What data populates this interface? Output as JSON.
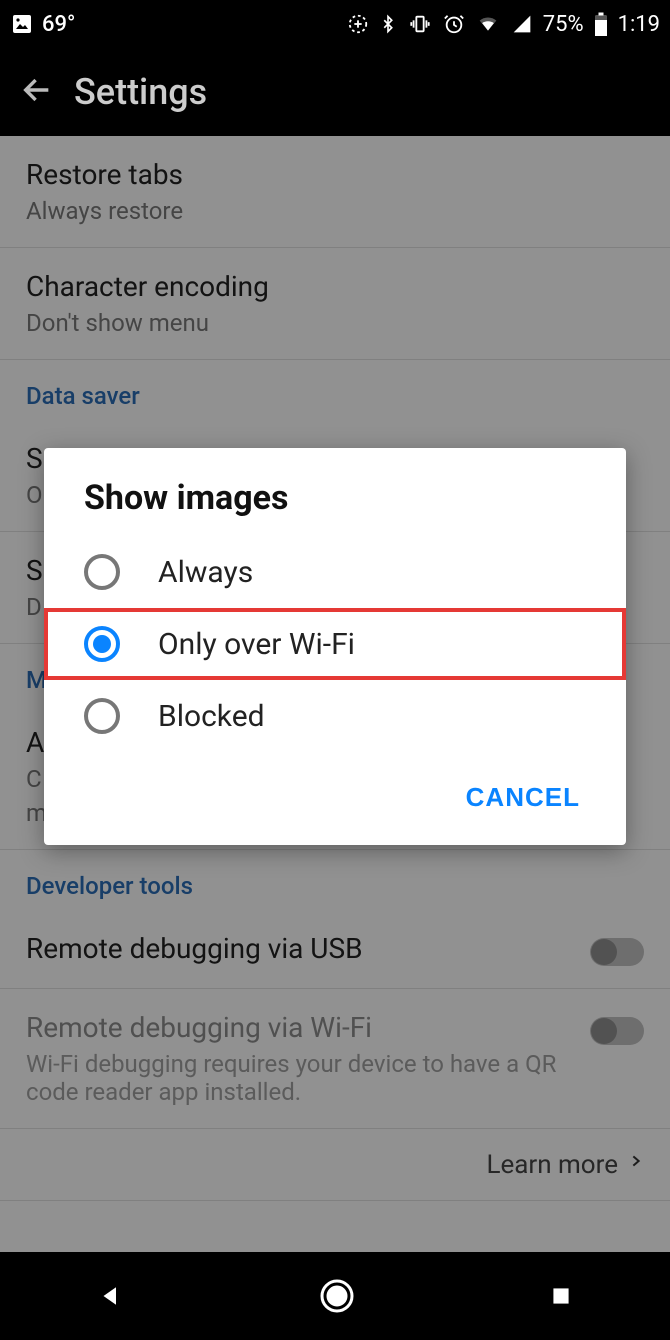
{
  "status_bar": {
    "temperature": "69°",
    "battery_percent": "75%",
    "clock": "1:19"
  },
  "app_bar": {
    "title": "Settings"
  },
  "content": {
    "restore_tabs": {
      "title": "Restore tabs",
      "subtitle": "Always restore"
    },
    "character_encoding": {
      "title": "Character encoding",
      "subtitle": "Don't show menu"
    },
    "section_data_saver": "Data saver",
    "show_images_partial": {
      "title_initial": "S",
      "subtitle_initial": "O"
    },
    "item_partial2": {
      "title_initial": "S",
      "subtitle_initial": "D"
    },
    "section_m": "M",
    "item_a": {
      "title_initial": "A",
      "subtitle1_initial": "C",
      "subtitle2_initial": "m"
    },
    "section_developer_tools": "Developer tools",
    "remote_debug_usb": {
      "title": "Remote debugging via USB"
    },
    "remote_debug_wifi": {
      "title": "Remote debugging via Wi-Fi",
      "subtitle": "Wi-Fi debugging requires your device to have a QR code reader app installed."
    },
    "learn_more": "Learn more"
  },
  "dialog": {
    "title": "Show images",
    "options": [
      {
        "label": "Always",
        "selected": false
      },
      {
        "label": "Only over Wi-Fi",
        "selected": true,
        "highlight": true
      },
      {
        "label": "Blocked",
        "selected": false
      }
    ],
    "cancel": "CANCEL"
  }
}
